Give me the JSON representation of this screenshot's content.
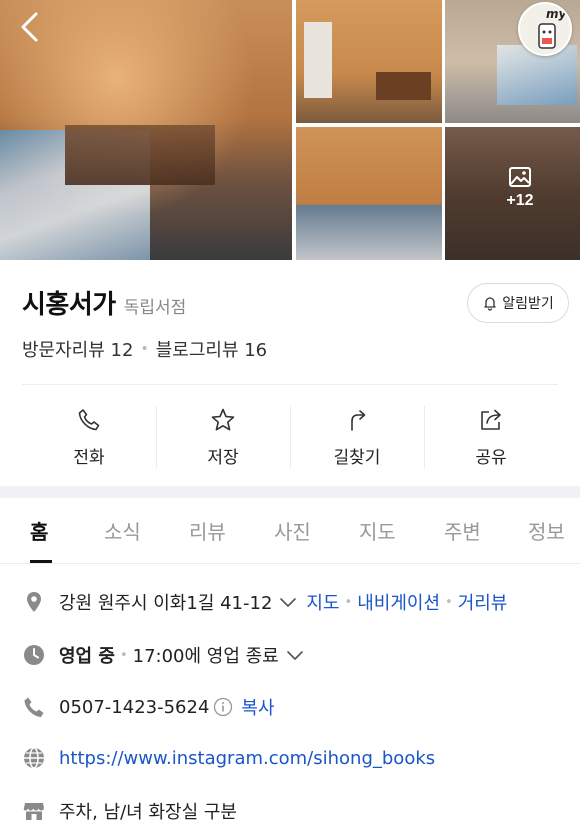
{
  "header": {
    "more_photos_count": "+12",
    "my_badge": "my"
  },
  "place": {
    "name": "시홍서가",
    "category": "독립서점",
    "notify_label": "알림받기",
    "visitor_reviews": "방문자리뷰 12",
    "blog_reviews": "블로그리뷰 16"
  },
  "actions": [
    {
      "label": "전화",
      "icon": "phone-icon"
    },
    {
      "label": "저장",
      "icon": "star-icon"
    },
    {
      "label": "길찾기",
      "icon": "directions-icon"
    },
    {
      "label": "공유",
      "icon": "share-icon"
    }
  ],
  "tabs": [
    {
      "label": "홈",
      "active": true
    },
    {
      "label": "소식"
    },
    {
      "label": "리뷰"
    },
    {
      "label": "사진"
    },
    {
      "label": "지도"
    },
    {
      "label": "주변"
    },
    {
      "label": "정보"
    }
  ],
  "info": {
    "address": "강원 원주시 이화1길 41-12",
    "map_link": "지도",
    "navigation_link": "내비게이션",
    "street_view_link": "거리뷰",
    "status": "영업 중",
    "hours": "17:00에 영업 종료",
    "phone": "0507-1423-5624",
    "copy_label": "복사",
    "website": "https://www.instagram.com/sihong_books",
    "amenities": "주차, 남/녀 화장실 구분"
  },
  "colors": {
    "link": "#1a56c9",
    "icon_gray": "#8a8a8a"
  }
}
